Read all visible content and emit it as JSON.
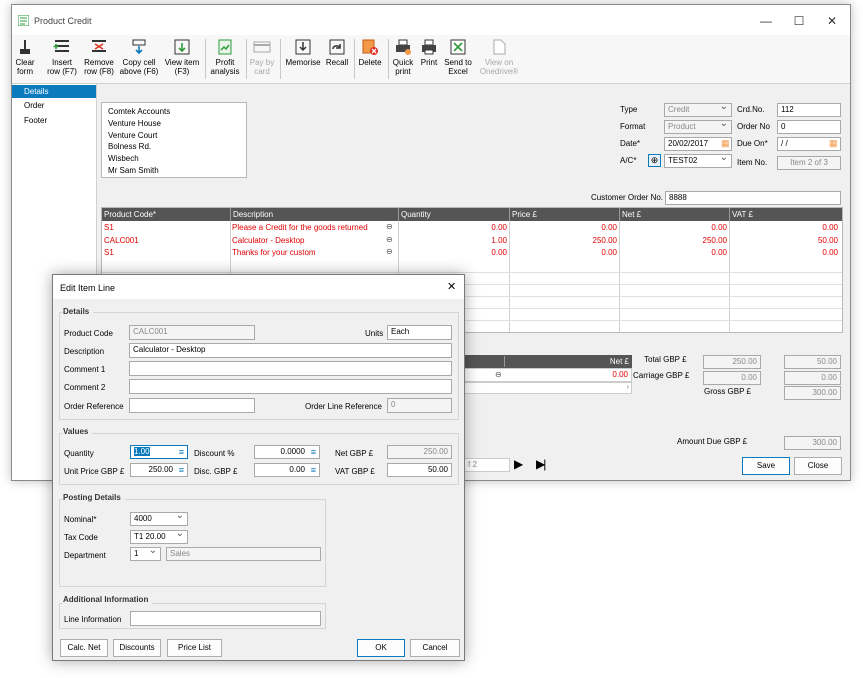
{
  "window": {
    "title": "Product Credit",
    "minimize": "—",
    "maximize": "☐",
    "close": "✕"
  },
  "ribbon": {
    "clear_form": [
      "Clear",
      "form"
    ],
    "insert_row": [
      "Insert",
      "row (F7)"
    ],
    "remove_row": [
      "Remove",
      "row (F8)"
    ],
    "copy_cell": [
      "Copy cell",
      "above (F6)"
    ],
    "view_item": [
      "View item",
      "(F3)"
    ],
    "profit_analysis": [
      "Profit",
      "analysis"
    ],
    "pay_by_card": [
      "Pay by",
      "card"
    ],
    "memorise": [
      "Memorise"
    ],
    "recall": [
      "Recall"
    ],
    "delete": [
      "Delete"
    ],
    "quick_print": [
      "Quick",
      "print"
    ],
    "print": [
      "Print"
    ],
    "send_to_excel": [
      "Send to",
      "Excel"
    ],
    "view_onedrive": [
      "View on",
      "Onedrive®"
    ]
  },
  "nav": {
    "items": [
      "Details",
      "Order",
      "Footer"
    ],
    "selected": "Details"
  },
  "address": [
    "Comtek Accounts",
    "Venture House",
    "Venture Court",
    "Bolness Rd.",
    "Wisbech",
    "Mr Sam Smith"
  ],
  "header": {
    "type_label": "Type",
    "type_value": "Credit",
    "format_label": "Format",
    "format_value": "Product",
    "date_label": "Date*",
    "date_value": "20/02/2017",
    "ac_label": "A/C*",
    "ac_value": "TEST02",
    "crdno_label": "Crd.No.",
    "crdno_value": "112",
    "orderno_label": "Order No",
    "orderno_value": "0",
    "dueon_label": "Due On*",
    "dueon_value": "/ /",
    "itemno_label": "Item No.",
    "itemno_value": "Item 2 of 3",
    "customer_order_label": "Customer Order No.",
    "customer_order_value": "8888"
  },
  "grid": {
    "columns": [
      "Product Code*",
      "Description",
      "Quantity",
      "Price £",
      "Net £",
      "VAT £"
    ],
    "rows": [
      {
        "code": "S1",
        "desc": "Please a Credit for the goods returned",
        "qty": "0.00",
        "price": "0.00",
        "net": "0.00",
        "vat": "0.00"
      },
      {
        "code": "CALC001",
        "desc": "Calculator - Desktop",
        "qty": "1.00",
        "price": "250.00",
        "net": "250.00",
        "vat": "50.00"
      },
      {
        "code": "S1",
        "desc": "Thanks for your custom",
        "qty": "0.00",
        "price": "0.00",
        "net": "0.00",
        "vat": "0.00"
      }
    ]
  },
  "footer_grid": {
    "net_header": "Net £",
    "net_value": "0.00",
    "page_text": "f 2"
  },
  "totals": {
    "total_label": "Total GBP £",
    "total_net": "250.00",
    "total_vat": "50.00",
    "carriage_label": "Carriage GBP £",
    "carriage_net": "0.00",
    "carriage_vat": "0.00",
    "gross_label": "Gross GBP £",
    "gross_value": "300.00",
    "amount_due_label": "Amount Due GBP £",
    "amount_due_value": "300.00"
  },
  "buttons": {
    "save": "Save",
    "close": "Close",
    "next": "▶",
    "last": "▶|"
  },
  "dialog": {
    "title": "Edit Item Line",
    "details_header": "Details",
    "product_code_label": "Product Code",
    "product_code_value": "CALC001",
    "units_label": "Units",
    "units_value": "Each",
    "description_label": "Description",
    "description_value": "Calculator - Desktop",
    "comment1_label": "Comment 1",
    "comment1_value": "",
    "comment2_label": "Comment 2",
    "comment2_value": "",
    "order_ref_label": "Order Reference",
    "order_ref_value": "",
    "order_line_ref_label": "Order Line Reference",
    "order_line_ref_value": "0",
    "values_header": "Values",
    "quantity_label": "Quantity",
    "quantity_value": "1.00",
    "discount_label": "Discount %",
    "discount_value": "0.0000",
    "net_label": "Net GBP £",
    "net_value": "250.00",
    "unit_price_label": "Unit Price GBP £",
    "unit_price_value": "250.00",
    "disc_label": "Disc. GBP £",
    "disc_value": "0.00",
    "vat_label": "VAT GBP £",
    "vat_value": "50.00",
    "posting_header": "Posting Details",
    "nominal_label": "Nominal*",
    "nominal_value": "4000",
    "tax_code_label": "Tax Code",
    "tax_code_value": "T1 20.00",
    "department_label": "Department",
    "department_value": "1",
    "department_name": "Sales",
    "additional_header": "Additional Information",
    "line_info_label": "Line Information",
    "line_info_value": "",
    "calc_net": "Calc. Net",
    "discounts": "Discounts",
    "price_list": "Price List",
    "ok": "OK",
    "cancel": "Cancel"
  },
  "colors": {
    "accent": "#0b7bbd",
    "negative_red": "#e00000",
    "grid_header": "#555555"
  }
}
